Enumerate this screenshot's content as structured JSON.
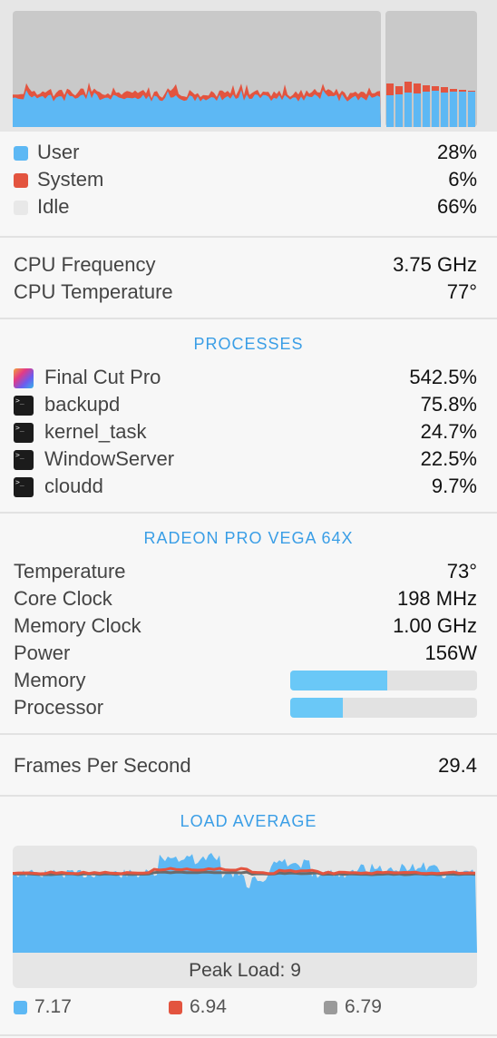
{
  "colors": {
    "user": "#5db8f4",
    "system": "#e3543f",
    "idle": "#e8e8e8",
    "accent": "#3a9ee6",
    "load_3": "#9a9a9a"
  },
  "cpu": {
    "user": {
      "label": "User",
      "value": "28%"
    },
    "system": {
      "label": "System",
      "value": "6%"
    },
    "idle": {
      "label": "Idle",
      "value": "66%"
    }
  },
  "cpu_info": {
    "frequency": {
      "label": "CPU Frequency",
      "value": "3.75 GHz"
    },
    "temperature": {
      "label": "CPU Temperature",
      "value": "77°"
    }
  },
  "processes": {
    "title": "PROCESSES",
    "items": [
      {
        "name": "Final Cut Pro",
        "value": "542.5%",
        "icon": "final-cut-pro-icon"
      },
      {
        "name": "backupd",
        "value": "75.8%",
        "icon": "terminal-icon"
      },
      {
        "name": "kernel_task",
        "value": "24.7%",
        "icon": "terminal-icon"
      },
      {
        "name": "WindowServer",
        "value": "22.5%",
        "icon": "terminal-icon"
      },
      {
        "name": "cloudd",
        "value": "9.7%",
        "icon": "terminal-icon"
      }
    ]
  },
  "gpu": {
    "title": "RADEON PRO VEGA 64X",
    "temperature": {
      "label": "Temperature",
      "value": "73°"
    },
    "core_clock": {
      "label": "Core Clock",
      "value": "198 MHz"
    },
    "memory_clock": {
      "label": "Memory Clock",
      "value": "1.00 GHz"
    },
    "power": {
      "label": "Power",
      "value": "156W"
    },
    "memory": {
      "label": "Memory",
      "fraction": 0.52
    },
    "processor": {
      "label": "Processor",
      "fraction": 0.28
    }
  },
  "fps": {
    "label": "Frames Per Second",
    "value": "29.4"
  },
  "load_average": {
    "title": "LOAD AVERAGE",
    "peak_label": "Peak Load: 9",
    "legend": [
      "7.17",
      "6.94",
      "6.79"
    ]
  }
}
